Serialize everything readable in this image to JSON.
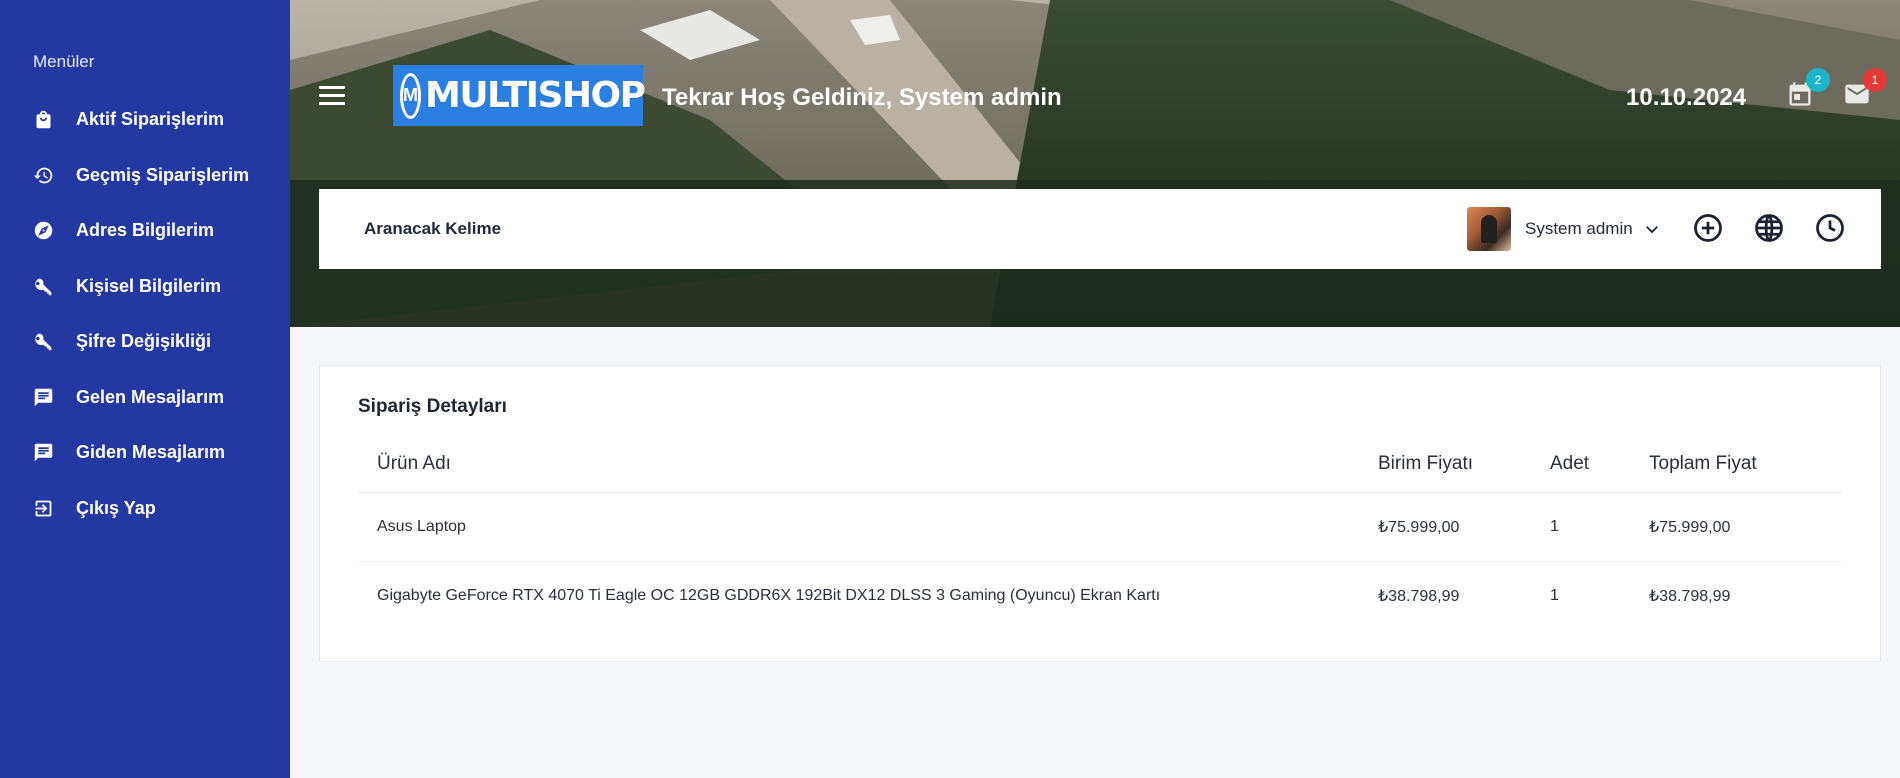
{
  "sidebar": {
    "title": "Menüler",
    "items": [
      {
        "label": "Aktif Siparişlerim",
        "icon": "shopping-bag-icon"
      },
      {
        "label": "Geçmiş Siparişlerim",
        "icon": "history-icon"
      },
      {
        "label": "Adres Bilgilerim",
        "icon": "compass-icon"
      },
      {
        "label": "Kişisel Bilgilerim",
        "icon": "key-icon"
      },
      {
        "label": "Şifre Değişikliği",
        "icon": "key-icon"
      },
      {
        "label": "Gelen Mesajlarım",
        "icon": "message-icon"
      },
      {
        "label": "Giden Mesajlarım",
        "icon": "message-icon"
      },
      {
        "label": "Çıkış Yap",
        "icon": "logout-icon"
      }
    ]
  },
  "header": {
    "logo_text": "MULTISHOP",
    "logo_badge": "M",
    "welcome": "Tekrar Hoş Geldiniz, System admin",
    "date": "10.10.2024",
    "notifications": [
      {
        "icon": "calendar-icon",
        "count": "2",
        "color": "#1fb5c8"
      },
      {
        "icon": "mail-icon",
        "count": "1",
        "color": "#e53935"
      }
    ]
  },
  "search": {
    "placeholder": "Aranacak Kelime"
  },
  "user": {
    "name": "System admin"
  },
  "card": {
    "title": "Sipariş Detayları",
    "columns": [
      "Ürün Adı",
      "Birim Fiyatı",
      "Adet",
      "Toplam Fiyat"
    ],
    "rows": [
      [
        "Asus Laptop",
        "₺75.999,00",
        "1",
        "₺75.999,00"
      ],
      [
        "Gigabyte GeForce RTX 4070 Ti Eagle OC 12GB GDDR6X 192Bit DX12 DLSS 3 Gaming (Oyuncu) Ekran Kartı",
        "₺38.798,99",
        "1",
        "₺38.798,99"
      ]
    ]
  },
  "colors": {
    "sidebar": "#2338a0",
    "logo": "#2b7fe0"
  }
}
